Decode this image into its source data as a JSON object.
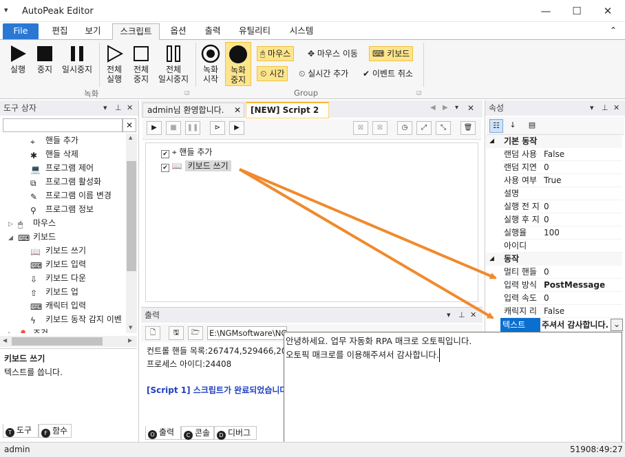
{
  "window": {
    "title": "AutoPeak Editor",
    "quick_access": "▾",
    "minimize_glyph": "—",
    "maximize_glyph": "☐",
    "close_glyph": "✕"
  },
  "ribbon_tabs": [
    "File",
    "편집",
    "보기",
    "스크립트",
    "옵션",
    "출력",
    "유틸리티",
    "시스템"
  ],
  "ribbon": {
    "collapse_glyph": "⌃",
    "run": "실행",
    "stop": "중지",
    "pause": "일시중지",
    "run_all_1": "전체",
    "run_all_2": "실행",
    "stop_all_1": "전체",
    "stop_all_2": "중지",
    "pause_all_1": "전체",
    "pause_all_2": "일시중지",
    "group_record": "녹화",
    "rec_start_1": "녹화",
    "rec_start_2": "시작",
    "rec_stop_1": "녹화",
    "rec_stop_2": "중지",
    "mouse": "마우스",
    "mouse_move": "마우스 이동",
    "keyboard": "키보드",
    "time": "시간",
    "realtime_add": "실시간 추가",
    "event_cancel": "이벤트 취소",
    "group_group": "Group"
  },
  "toolbox": {
    "title": "도구 상자",
    "items": [
      {
        "label": "핸들 추가",
        "indent": 2,
        "icon": "crosshair-icon"
      },
      {
        "label": "핸들 삭제",
        "indent": 2,
        "icon": "remove-handle-icon"
      },
      {
        "label": "프로그램 제어",
        "indent": 2,
        "icon": "laptop-icon"
      },
      {
        "label": "프로그램 활성화",
        "indent": 2,
        "icon": "activate-window-icon"
      },
      {
        "label": "프로그램 이름 변경",
        "indent": 2,
        "icon": "rename-icon"
      },
      {
        "label": "프로그램 정보",
        "indent": 2,
        "icon": "magnifier-icon"
      },
      {
        "label": "마우스",
        "indent": 1,
        "icon": "mouse-icon",
        "expander": "▷"
      },
      {
        "label": "키보드",
        "indent": 1,
        "icon": "keyboard-icon",
        "expander": "◢"
      },
      {
        "label": "키보드 쓰기",
        "indent": 2,
        "icon": "book-icon"
      },
      {
        "label": "키보드 입력",
        "indent": 2,
        "icon": "keyboard-icon"
      },
      {
        "label": "키보드 다운",
        "indent": 2,
        "icon": "key-down-icon"
      },
      {
        "label": "키보드 업",
        "indent": 2,
        "icon": "key-up-icon"
      },
      {
        "label": "캐릭터 입력",
        "indent": 2,
        "icon": "char-input-icon"
      },
      {
        "label": "키보드 동작 감지 이벤",
        "indent": 2,
        "icon": "lightning-icon"
      },
      {
        "label": "조건",
        "indent": 1,
        "icon": "pin-icon",
        "expander": "▷"
      }
    ],
    "desc_title": "키보드 쓰기",
    "desc_text": "텍스트를 씁니다.",
    "bottom_tabs": [
      {
        "letter": "T",
        "label": "도구"
      },
      {
        "letter": "F",
        "label": "함수"
      }
    ]
  },
  "doc_tabs": {
    "tab1": "admin님 환영합니다.",
    "tab2": "[NEW] Script 2"
  },
  "script_tree": [
    {
      "label": "핸들 추가",
      "checked": true,
      "icon": "crosshair-icon"
    },
    {
      "label": "키보드 쓰기",
      "checked": true,
      "icon": "book-icon",
      "selected": true
    }
  ],
  "output": {
    "title": "출력",
    "path": "E:\\NGMsoftware\\NG",
    "zoom": "1000",
    "lines": [
      {
        "text": "컨트롤 핸들 목록:267474,529466,20",
        "color": "#1e1e1e",
        "bold": false
      },
      {
        "text": "프로세스 아이디:24408",
        "color": "#1e1e1e",
        "bold": false
      },
      {
        "text": "",
        "color": "#1e1e1e",
        "bold": false
      },
      {
        "text": "[Script 1] 스크립트가 완료되었습니다",
        "color": "#1f3fbf",
        "bold": true
      }
    ],
    "tabs": [
      {
        "letter": "O",
        "label": "출력"
      },
      {
        "letter": "C",
        "label": "콘솔"
      },
      {
        "letter": "D",
        "label": "디버그"
      }
    ]
  },
  "properties": {
    "title": "속성",
    "cat1": "기본 동작",
    "rows1": [
      {
        "key": "랜덤 사용",
        "value": "False"
      },
      {
        "key": "랜덤 지연",
        "value": "0"
      },
      {
        "key": "사용 여부",
        "value": "True"
      },
      {
        "key": "설명",
        "value": ""
      },
      {
        "key": "실행 전 지",
        "value": "0"
      },
      {
        "key": "실행 후 지",
        "value": "0"
      },
      {
        "key": "실행율",
        "value": "100"
      },
      {
        "key": "아이디",
        "value": ""
      }
    ],
    "cat2": "동작",
    "rows2": [
      {
        "key": "멀티 핸들",
        "value": "0",
        "bold": false
      },
      {
        "key": "입력 방식",
        "value": "PostMessage",
        "bold": true
      },
      {
        "key": "입력 속도",
        "value": "0",
        "bold": false
      },
      {
        "key": "캐릭지 리",
        "value": "False",
        "bold": false
      }
    ],
    "selected_key": "텍스트",
    "selected_value": "주셔서 감사합니다.",
    "dropdown_glyph": "⌄"
  },
  "text_editor": {
    "line1": "안녕하세요. 업무 자동화 RPA 매크로 오토픽입니다.",
    "line2": "오토픽 매크로를 이용해주셔서 감사합니다."
  },
  "status": {
    "user": "admin",
    "right": "51908:49:27"
  },
  "colors": {
    "accent": "#2b78d4",
    "highlight": "#fde58c",
    "arrow": "#f08a2c",
    "selected": "#0b6fd0"
  }
}
